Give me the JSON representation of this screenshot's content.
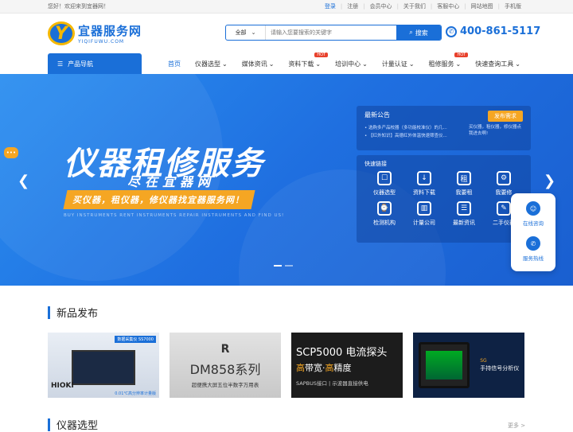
{
  "topbar": {
    "welcome": "您好！欢迎来到宜器网！",
    "login": "登录",
    "register": "注册",
    "member": "会员中心",
    "about": "关于我们",
    "service": "客服中心",
    "sitemap": "网站地图",
    "mobile": "手机版"
  },
  "logo": {
    "cn": "宜器服务网",
    "en": "YIQIFUWU.COM",
    "letter": "Y"
  },
  "search": {
    "category": "全部",
    "placeholder": "请输入您要搜索的关键字",
    "button": "搜索"
  },
  "phone": "400-861-5117",
  "nav": {
    "product_nav": "产品导航",
    "items": [
      {
        "label": "首页"
      },
      {
        "label": "仪器选型"
      },
      {
        "label": "媒体资讯"
      },
      {
        "label": "资料下载",
        "hot": "HOT"
      },
      {
        "label": "培训中心"
      },
      {
        "label": "计量认证"
      },
      {
        "label": "租修服务",
        "hot": "HOT"
      },
      {
        "label": "快速查询工具"
      }
    ]
  },
  "banner": {
    "headline": "仪器租修服务",
    "subline": "尽在宜器网",
    "slogan": "买仪器，租仪器，修仪器找宜器服务网！",
    "english": "BUY INSTRUMENTS  RENT INSTRUMENTS  REPAIR INSTRUMENTS AND FIND US!"
  },
  "notice": {
    "title": "最新公告",
    "rows": [
      "选购多产品校器（多功能校准仪）的几...",
      "【红外知识】高德红外体温快速筛查仪..."
    ],
    "publish": "发布需求",
    "publish_text": "买仪器，租仪器，修仪器点我进去啊!"
  },
  "quick": {
    "title": "快速链接",
    "items": [
      {
        "label": "仪器选型",
        "icon": "☐"
      },
      {
        "label": "资料下载",
        "icon": "↓"
      },
      {
        "label": "我要租",
        "icon": "租"
      },
      {
        "label": "我要修",
        "icon": "⚙"
      },
      {
        "label": "检测机构",
        "icon": "⌚"
      },
      {
        "label": "计量公司",
        "icon": "▥"
      },
      {
        "label": "最新资讯",
        "icon": "☰"
      },
      {
        "label": "二手仪器",
        "icon": "✎"
      }
    ]
  },
  "float": {
    "consult": "在线咨询",
    "hotline": "服务热线"
  },
  "section1": {
    "title": "新品发布"
  },
  "products": {
    "p1": {
      "brand": "HIOKI",
      "label": "数据采集仪 SS7000",
      "caption": "0.01℃高分辨率计量版"
    },
    "p2": {
      "logo": "R",
      "title": "DM858系列",
      "sub": "超便携大屏五位半数字万用表"
    },
    "p3": {
      "title": "SCP5000 电流探头",
      "line_a": "高",
      "line_b": "带宽·",
      "line_c": "高",
      "line_d": "精度",
      "sub": "SAPBUS接口 | 示波器直接供电"
    },
    "p4": {
      "line1": "手持信号分析仪",
      "line2": "SG"
    }
  },
  "section2": {
    "title": "仪器选型",
    "more": "更多 >"
  }
}
